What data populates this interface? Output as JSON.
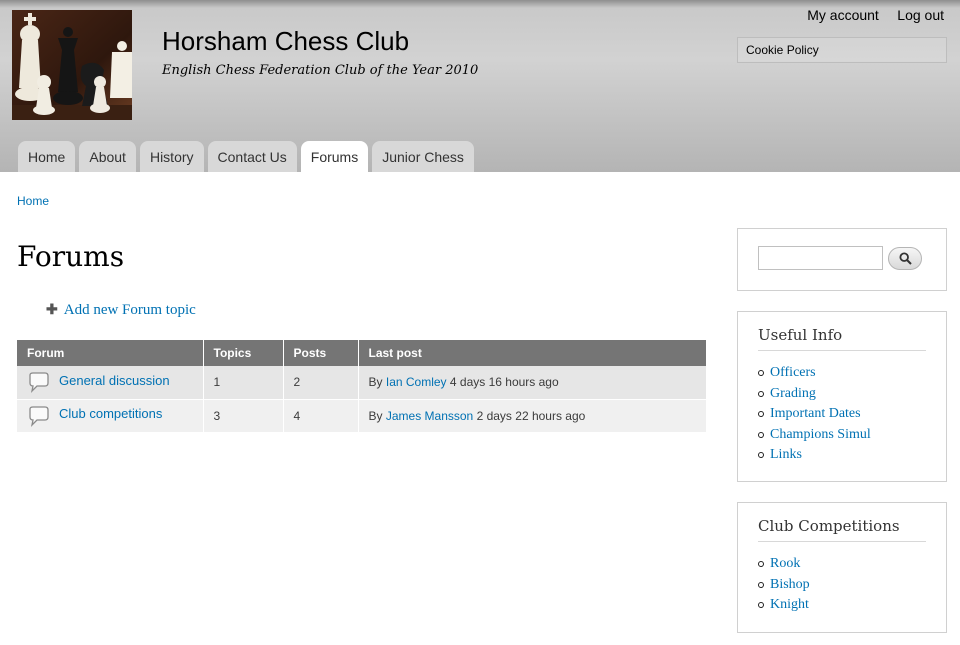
{
  "header": {
    "site_name": "Horsham Chess Club",
    "slogan": "English Chess Federation Club of the Year 2010",
    "secondary_menu": [
      {
        "label": "My account"
      },
      {
        "label": "Log out"
      }
    ],
    "cookie_policy": "Cookie Policy",
    "logo_icon": "chess-pieces-photo"
  },
  "main_menu": [
    {
      "label": "Home",
      "active": false
    },
    {
      "label": "About",
      "active": false
    },
    {
      "label": "History",
      "active": false
    },
    {
      "label": "Contact Us",
      "active": false
    },
    {
      "label": "Forums",
      "active": true
    },
    {
      "label": "Junior Chess",
      "active": false
    }
  ],
  "breadcrumb": {
    "home": "Home"
  },
  "page": {
    "title": "Forums",
    "add_topic": "Add new Forum topic"
  },
  "forum_table": {
    "headers": {
      "forum": "Forum",
      "topics": "Topics",
      "posts": "Posts",
      "last_post": "Last post"
    },
    "rows": [
      {
        "name": "General discussion",
        "topics": "1",
        "posts": "2",
        "by": "By",
        "author": "Ian Comley",
        "time": "4 days 16 hours ago"
      },
      {
        "name": "Club competitions",
        "topics": "3",
        "posts": "4",
        "by": "By",
        "author": "James Mansson",
        "time": "2 days 22 hours ago"
      }
    ]
  },
  "sidebar": {
    "search": {
      "placeholder": "",
      "button_icon": "search-icon"
    },
    "useful_info": {
      "title": "Useful Info",
      "items": [
        "Officers",
        "Grading",
        "Important Dates",
        "Champions Simul",
        "Links"
      ]
    },
    "club_competitions": {
      "title": "Club Competitions",
      "items": [
        "Rook",
        "Bishop",
        "Knight"
      ]
    }
  },
  "colors": {
    "link": "#0071B3",
    "table_header": "#757575"
  }
}
